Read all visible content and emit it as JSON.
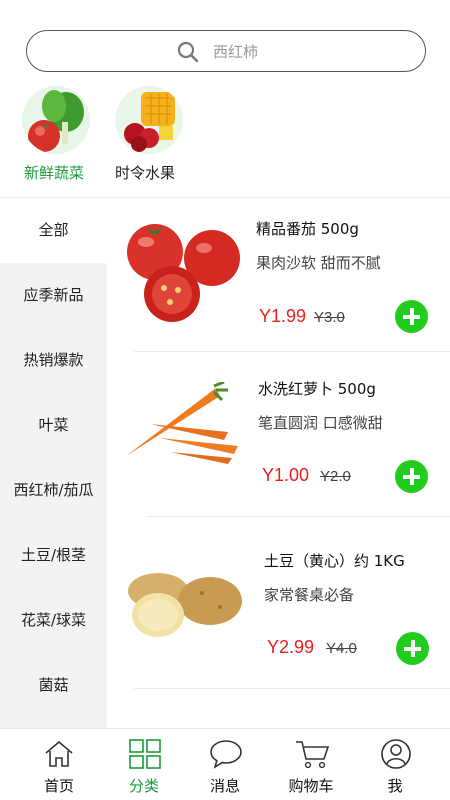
{
  "search": {
    "placeholder": "西红柿"
  },
  "categories": [
    {
      "label": "新鲜蔬菜",
      "active": true
    },
    {
      "label": "时令水果",
      "active": false
    }
  ],
  "sidebar": {
    "items": [
      {
        "label": "全部"
      },
      {
        "label": "应季新品"
      },
      {
        "label": "热销爆款"
      },
      {
        "label": "叶菜"
      },
      {
        "label": "西红柿/茄瓜"
      },
      {
        "label": "土豆/根茎"
      },
      {
        "label": "花菜/球菜"
      },
      {
        "label": "菌菇"
      }
    ],
    "active_index": 0
  },
  "products": [
    {
      "name": "精品番茄  500g",
      "desc": "果肉沙软 甜而不腻",
      "price": "Y1.99",
      "old_price": "Y3.0"
    },
    {
      "name": "水洗红萝卜  500g",
      "desc": "笔直圆润 口感微甜",
      "price": "Y1.00",
      "old_price": "Y2.0"
    },
    {
      "name": "土豆（黄心）约 1KG",
      "desc": "家常餐桌必备",
      "price": "Y2.99",
      "old_price": "Y4.0"
    }
  ],
  "tabbar": {
    "items": [
      {
        "label": "首页",
        "icon": "home-icon"
      },
      {
        "label": "分类",
        "icon": "grid-icon"
      },
      {
        "label": "消息",
        "icon": "chat-icon"
      },
      {
        "label": "购物车",
        "icon": "cart-icon"
      },
      {
        "label": "我",
        "icon": "user-icon"
      }
    ],
    "active_index": 1
  },
  "colors": {
    "accent_green": "#1a9a39",
    "add_button": "#21cc1f",
    "price_red": "#e8211d",
    "sidebar_bg": "#f3f3f3"
  }
}
